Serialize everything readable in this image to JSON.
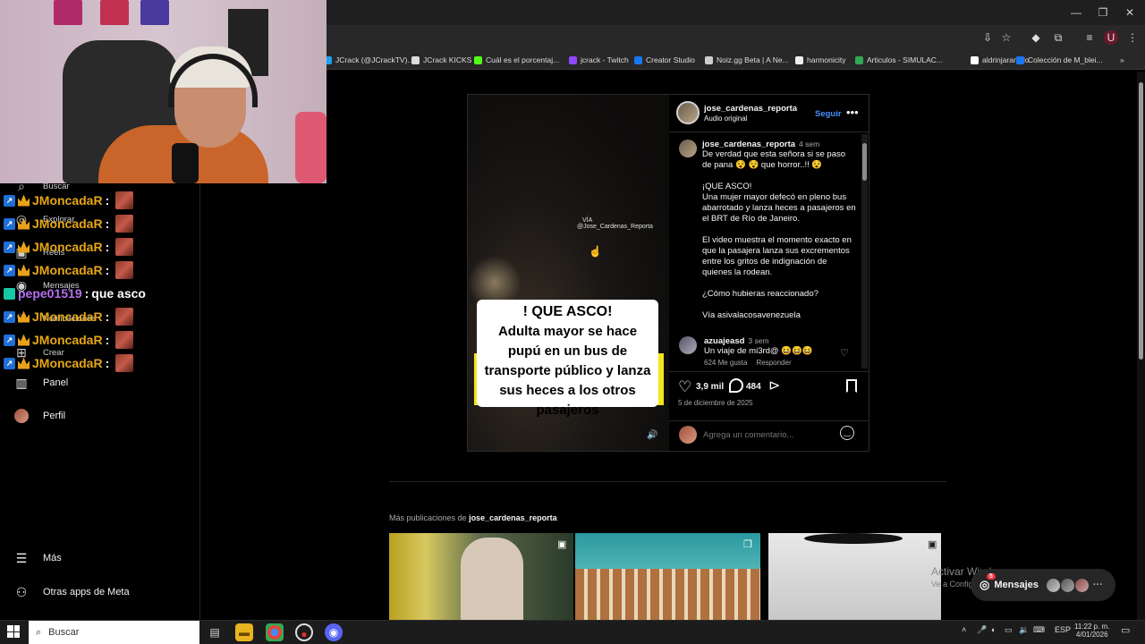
{
  "browser": {
    "bookmarks": [
      {
        "label": "JCrack (@JCrackTV)...",
        "color": "#1da1f2"
      },
      {
        "label": "JCrack KICKS",
        "color": "#dddddd"
      },
      {
        "label": "Cuál es el porcentaj...",
        "color": "#53fc18"
      },
      {
        "label": "jcrack - Twitch",
        "color": "#9146ff"
      },
      {
        "label": "Creator Studio",
        "color": "#1877f2"
      },
      {
        "label": "Noiz.gg Beta | A Ne...",
        "color": "#cccccc"
      },
      {
        "label": "harmonicity",
        "color": "#eeeeee"
      },
      {
        "label": "Articulos - SIMULAC...",
        "color": "#34a853"
      },
      {
        "label": "aldrinjaramillo",
        "color": "#ffffff"
      },
      {
        "label": "Colección de M_blei...",
        "color": "#1877f2"
      }
    ],
    "more_bookmarks": "»"
  },
  "chat": [
    {
      "user": "JMoncadaR",
      "message": "",
      "emote": true,
      "style": "gold"
    },
    {
      "user": "JMoncadaR",
      "message": "",
      "emote": true,
      "style": "gold"
    },
    {
      "user": "JMoncadaR",
      "message": "",
      "emote": true,
      "style": "gold"
    },
    {
      "user": "JMoncadaR",
      "message": "",
      "emote": true,
      "style": "gold"
    },
    {
      "user": "pepe01519",
      "message": "que asco",
      "emote": false,
      "style": "purple"
    },
    {
      "user": "JMoncadaR",
      "message": "",
      "emote": true,
      "style": "gold"
    },
    {
      "user": "JMoncadaR",
      "message": "",
      "emote": true,
      "style": "gold"
    },
    {
      "user": "JMoncadaR",
      "message": "",
      "emote": true,
      "style": "gold"
    }
  ],
  "sidebar": {
    "partial_labels": [
      "Buscar",
      "Explorar",
      "Reels",
      "Mensajes",
      "Notificaciones",
      "Crear"
    ],
    "items": [
      {
        "label": "Panel",
        "icon": "panel-icon"
      },
      {
        "label": "Perfil",
        "icon": "avatar"
      },
      {
        "label": "Más",
        "icon": "menu-icon"
      },
      {
        "label": "Otras apps de Meta",
        "icon": "meta-apps-icon"
      }
    ]
  },
  "post": {
    "author": "jose_cardenas_reporta",
    "audio": "Audio original",
    "follow_label": "Seguir",
    "video": {
      "watermark_via": "VÍA",
      "watermark_handle": "@Jose_Cardenas_Reporta",
      "caption_title": "! QUE ASCO!",
      "caption_body": "Adulta mayor se hace pupú en un bus de transporte público y lanza sus heces a los otros pasajeros"
    },
    "description": {
      "author": "jose_cardenas_reporta",
      "age": "4 sem",
      "line1": "De verdad que esta señora si se paso de pana 😵 😵 que horror..!! 😵",
      "para2": "¡QUE ASCO!\nUna mujer mayor defecó en pleno bus abarrotado y lanza heces a pasajeros en el BRT de Río de Janeiro.",
      "para3": "El video muestra el momento exacto en que la pasajera lanza sus excrementos entre los gritos de indignación de quienes la rodean.",
      "para4": "¿Cómo hubieras reaccionado?",
      "para5": "Vía asivalacosavenezuela"
    },
    "comment": {
      "author": "azuajeasd",
      "age": "3 sem",
      "text": "Un viaje de mi3rd@ 😆😆😆",
      "likes": "624 Me gusta",
      "reply": "Responder"
    },
    "likes": "3,9 mil",
    "comments": "484",
    "date": "5 de diciembre de 2025",
    "comment_placeholder": "Agrega un comentario..."
  },
  "more_posts": {
    "prefix": "Más publicaciones de ",
    "author": "jose_cardenas_reporta"
  },
  "windows_watermark": {
    "title": "Activar Windows",
    "subtitle": "Ve a Configuración para activar Windows."
  },
  "messages_pill": {
    "label": "Mensajes",
    "count": "5"
  },
  "taskbar": {
    "search_placeholder": "Buscar",
    "lang": "ESP",
    "time": "11:22 p. m.",
    "date": "4/01/2026"
  },
  "colors": {
    "accent_link": "#4a90ff",
    "chat_gold": "#e6a616",
    "chat_purple": "#b96ef0",
    "caption_yellow": "#f3e61a"
  }
}
